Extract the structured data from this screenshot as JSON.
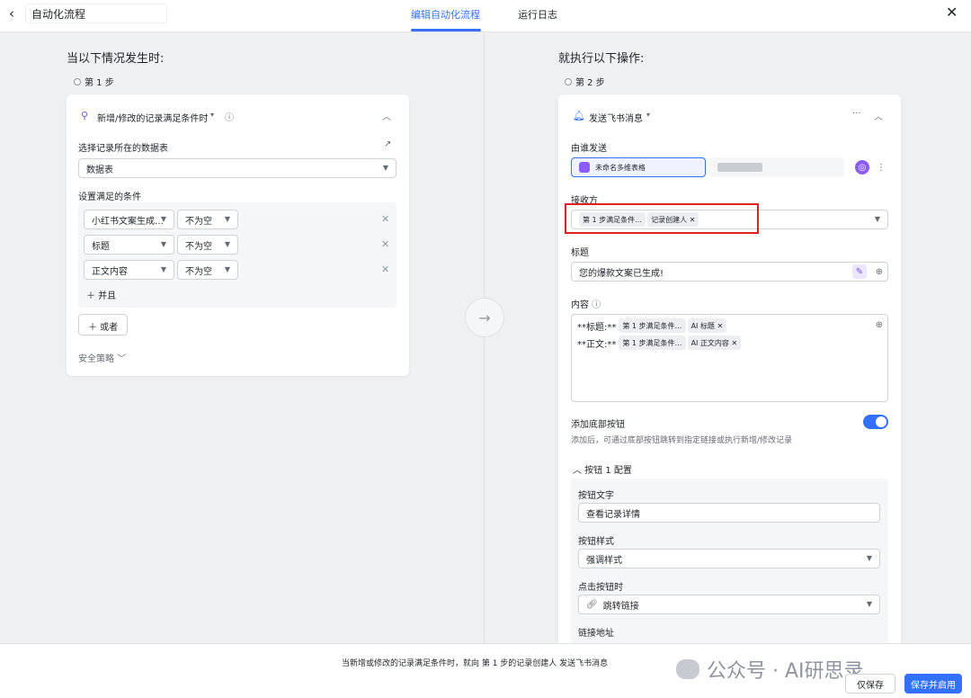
{
  "topbar": {
    "back_glyph": "‹",
    "flow_title": "自动化流程",
    "tabs": [
      {
        "label": "编辑自动化流程",
        "active": true
      },
      {
        "label": "运行日志",
        "active": false
      }
    ],
    "close_glyph": "✕"
  },
  "left": {
    "heading": "当以下情况发生时:",
    "step_label": "第 1 步",
    "trigger": {
      "label": "新增/修改的记录满足条件时",
      "caret": "▾",
      "info_glyph": "ⓘ",
      "collapse_glyph": "︿"
    },
    "table_label": "选择记录所在的数据表",
    "table_value": "数据表",
    "conditions_label": "设置满足的条件",
    "conditions": [
      {
        "field": "小红书文案生成…",
        "op": "不为空"
      },
      {
        "field": "标题",
        "op": "不为空"
      },
      {
        "field": "正文内容",
        "op": "不为空"
      }
    ],
    "and_label": "＋ 并且",
    "or_label": "＋ 或者",
    "security_label": "安全策略 ﹀"
  },
  "right": {
    "heading": "就执行以下操作:",
    "step_label": "第 2 步",
    "action": {
      "label": "发送飞书消息",
      "caret": "▾",
      "more_glyph": "···",
      "collapse_glyph": "︿"
    },
    "sender_label": "由谁发送",
    "sender_value": "未命名多维表格",
    "receiver_label": "接收方",
    "receiver_tags": [
      "第 1 步满足条件…",
      "记录创建人 ✕"
    ],
    "title_label": "标题",
    "title_value": "您的爆款文案已生成!",
    "content_label": "内容",
    "content_lines": [
      {
        "prefix": "**标题:**",
        "tags": [
          "第 1 步满足条件…",
          "AI 标题 ✕"
        ]
      },
      {
        "prefix": "**正文:**",
        "tags": [
          "第 1 步满足条件…",
          "AI 正文内容 ✕"
        ]
      }
    ],
    "bottom_button_label": "添加底部按钮",
    "bottom_button_hint": "添加后，可通过底部按钮跳转到指定链接或执行新增/修改记录",
    "bottom_button_enabled": true,
    "button_config_label": "︿  按钮 1 配置",
    "button_text_label": "按钮文字",
    "button_text_value": "查看记录详情",
    "button_style_label": "按钮样式",
    "button_style_value": "强调样式",
    "on_click_label": "点击按钮时",
    "on_click_value": "跳转链接",
    "link_label": "链接地址"
  },
  "footer": {
    "summary": "当新增或修改的记录满足条件时，就向 第 1 步的记录创建人 发送飞书消息",
    "watermark": "公众号 · AI研思录",
    "save_label": "仅保存",
    "save_enable_label": "保存并启用"
  },
  "colors": {
    "accent": "#3370ff",
    "highlight_border": "#e02020",
    "panel_bg": "#eff0f1"
  }
}
